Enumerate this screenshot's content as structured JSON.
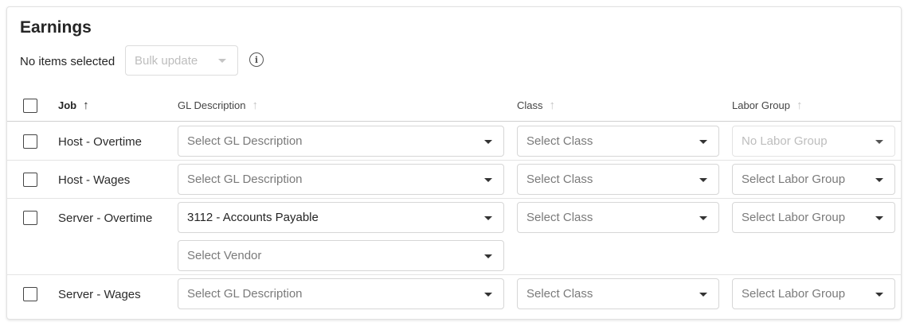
{
  "section": {
    "title": "Earnings"
  },
  "toolbar": {
    "selection_status": "No items selected",
    "bulk_update_label": "Bulk update"
  },
  "columns": {
    "job": "Job",
    "gl": "GL Description",
    "class": "Class",
    "labor": "Labor Group"
  },
  "rows": [
    {
      "job": "Host - Overtime",
      "gl": "Select GL Description",
      "class": "Select Class",
      "labor": "No Labor Group"
    },
    {
      "job": "Host - Wages",
      "gl": "Select GL Description",
      "class": "Select Class",
      "labor": "Select Labor Group"
    },
    {
      "job": "Server - Overtime",
      "gl": "3112 - Accounts Payable",
      "vendor": "Select Vendor",
      "class": "Select Class",
      "labor": "Select Labor Group"
    },
    {
      "job": "Server - Wages",
      "gl": "Select GL Description",
      "class": "Select Class",
      "labor": "Select Labor Group"
    }
  ],
  "icons": {
    "info": "info-icon",
    "sort": "arrow-up-icon",
    "dropdown": "caret-down-icon"
  }
}
